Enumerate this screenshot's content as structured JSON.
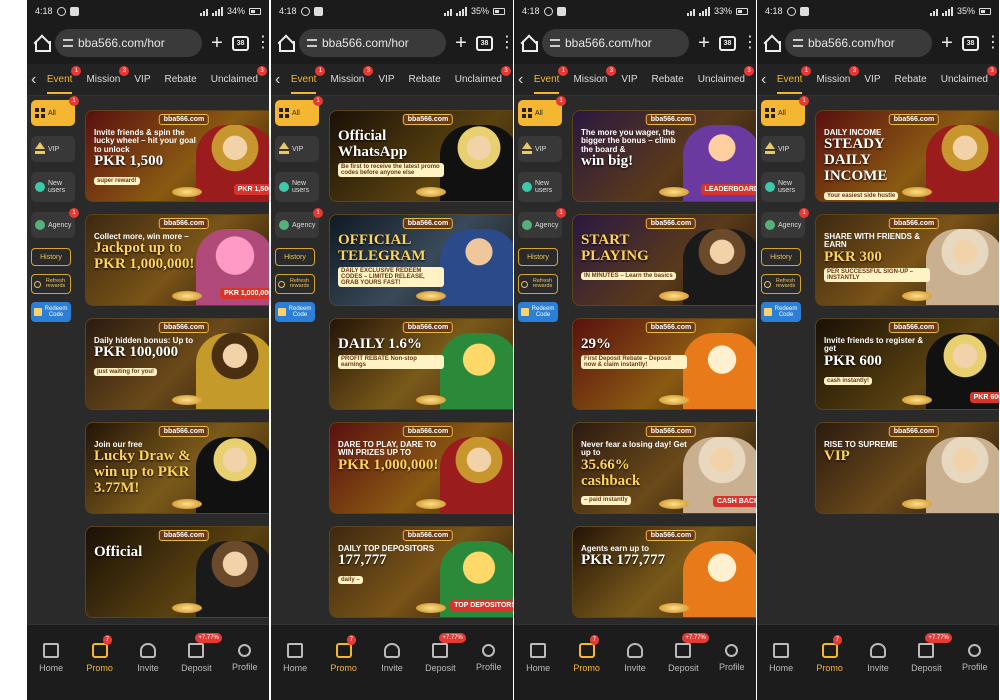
{
  "colors": {
    "accent": "#f5b731",
    "badge": "#e53935",
    "panel": "#2a2a2a",
    "bar": "#1b1b1b"
  },
  "browser": {
    "url": "bba566.com/hor",
    "tab_count": "38"
  },
  "tabs": [
    {
      "label": "Event",
      "badge": "1"
    },
    {
      "label": "Mission",
      "badge": "3"
    },
    {
      "label": "VIP",
      "badge": ""
    },
    {
      "label": "Rebate",
      "badge": ""
    },
    {
      "label": "Unclaimed",
      "badge": "3"
    }
  ],
  "sidenav": {
    "all": "All",
    "all_badge": "1",
    "vip": "VIP",
    "new_users": "New users",
    "agency": "Agency",
    "agency_badge": "1",
    "history": "History",
    "refresh": "Refresh rewards",
    "redeem": "Redeem Code"
  },
  "bottomnav": {
    "home": "Home",
    "promo": "Promo",
    "promo_badge": "7",
    "invite": "Invite",
    "deposit": "Deposit",
    "deposit_badge": "+7.77%",
    "profile": "Profile"
  },
  "logo": "bba566.com",
  "phones": [
    {
      "time": "4:18",
      "battery": "34%",
      "banners": [
        {
          "small": "Invite friends & spin the lucky wheel – hit your goal to unlock",
          "big": "PKR 1,500",
          "small2": "super reward!",
          "chip": "PKR 1,500"
        },
        {
          "small": "Collect more, win more –",
          "big": "Jackpot up to PKR 1,000,000!",
          "small2": "",
          "chip": "PKR 1,000,000"
        },
        {
          "small": "Daily hidden bonus: Up to",
          "big": "PKR 100,000",
          "small2": "just waiting for you!",
          "chip": ""
        },
        {
          "small": "Join our free",
          "big": "Lucky Draw & win up to PKR 3.77M!",
          "small2": "",
          "chip": ""
        },
        {
          "small": "",
          "big": "Official",
          "small2": "",
          "chip": ""
        }
      ]
    },
    {
      "time": "4:18",
      "battery": "35%",
      "banners": [
        {
          "small": "",
          "big": "Official WhatsApp",
          "small2": "Be first to receive the latest promo codes before anyone else",
          "chip": ""
        },
        {
          "small": "",
          "big": "OFFICIAL TELEGRAM",
          "small2": "DAILY EXCLUSIVE REDEEM CODES – LIMITED RELEASE, GRAB YOURS FAST!",
          "chip": ""
        },
        {
          "small": "",
          "big": "DAILY 1.6%",
          "small2": "PROFIT REBATE Non-stop earnings",
          "chip": ""
        },
        {
          "small": "DARE TO PLAY, DARE TO WIN PRIZES UP TO",
          "big": "PKR 1,000,000!",
          "small2": "",
          "chip": ""
        },
        {
          "small": "DAILY TOP DEPOSITORS",
          "big": "177,777",
          "small2": "daily –",
          "chip": "TOP DEPOSITORS"
        }
      ]
    },
    {
      "time": "4:18",
      "battery": "33%",
      "banners": [
        {
          "small": "The more you wager, the bigger the bonus – climb the board &",
          "big": "win big!",
          "small2": "",
          "chip": "LEADERBOARD"
        },
        {
          "small": "",
          "big": "START PLAYING",
          "small2": "IN MINUTES – Learn the basics",
          "chip": ""
        },
        {
          "small": "",
          "big": "29%",
          "small2": "First Deposit Rebate – Deposit now & claim instantly!",
          "chip": ""
        },
        {
          "small": "Never fear a losing day! Get up to",
          "big": "35.66% cashback",
          "small2": "– paid instantly",
          "chip": "CASH BACK"
        },
        {
          "small": "Agents earn up to",
          "big": "PKR 177,777",
          "small2": "",
          "chip": ""
        }
      ]
    },
    {
      "time": "4:18",
      "battery": "35%",
      "banners": [
        {
          "small": "DAILY INCOME",
          "big": "STEADY DAILY INCOME",
          "small2": "Your easiest side hustle",
          "chip": ""
        },
        {
          "small": "SHARE WITH FRIENDS & EARN",
          "big": "PKR 300",
          "small2": "PER SUCCESSFUL SIGN-UP – INSTANTLY",
          "chip": ""
        },
        {
          "small": "Invite friends to register & get",
          "big": "PKR 600",
          "small2": "cash instantly!",
          "chip": "PKR 600"
        },
        {
          "small": "RISE TO SUPREME",
          "big": "VIP",
          "small2": "",
          "chip": ""
        }
      ]
    }
  ]
}
